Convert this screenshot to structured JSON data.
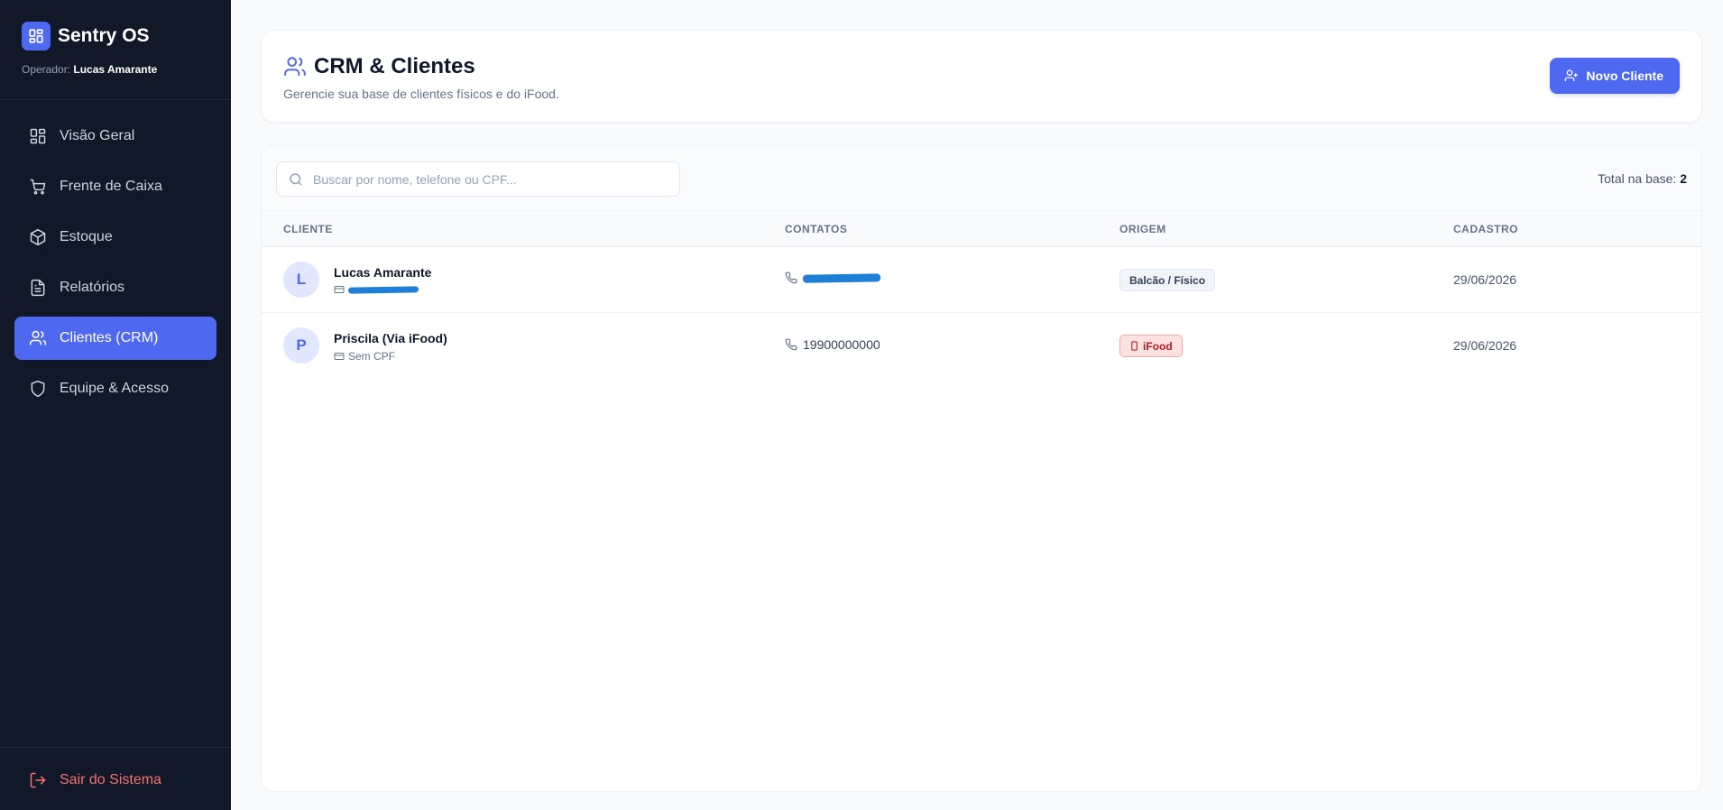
{
  "app": {
    "name": "Sentry OS",
    "operator_label": "Operador:",
    "operator_name": "Lucas Amarante"
  },
  "sidebar": {
    "items": [
      {
        "label": "Visão Geral",
        "icon": "dashboard-icon"
      },
      {
        "label": "Frente de Caixa",
        "icon": "cart-icon"
      },
      {
        "label": "Estoque",
        "icon": "package-icon"
      },
      {
        "label": "Relatórios",
        "icon": "report-icon"
      },
      {
        "label": "Clientes (CRM)",
        "icon": "users-icon",
        "active": true
      },
      {
        "label": "Equipe & Acesso",
        "icon": "shield-icon"
      }
    ],
    "logout_label": "Sair do Sistema"
  },
  "header": {
    "title": "CRM & Clientes",
    "subtitle": "Gerencie sua base de clientes físicos e do iFood.",
    "new_button_label": "Novo Cliente"
  },
  "table": {
    "search_placeholder": "Buscar por nome, telefone ou CPF...",
    "total_label": "Total na base:",
    "total_value": "2",
    "columns": [
      "CLIENTE",
      "CONTATOS",
      "ORIGEM",
      "CADASTRO"
    ],
    "rows": [
      {
        "initial": "L",
        "name": "Lucas Amarante",
        "doc": "",
        "doc_redacted": true,
        "phone": "",
        "phone_redacted": true,
        "origin": "Balcão / Físico",
        "origin_type": "physical",
        "date": "29/06/2026"
      },
      {
        "initial": "P",
        "name": "Priscila (Via iFood)",
        "doc": "Sem CPF",
        "doc_redacted": false,
        "phone": "19900000000",
        "phone_redacted": false,
        "origin": "iFood",
        "origin_type": "ifood",
        "date": "29/06/2026"
      }
    ]
  },
  "colors": {
    "accent": "#4f68f0",
    "sidebar_bg": "#111827",
    "danger": "#f87171",
    "redaction": "#1f7fd6"
  }
}
